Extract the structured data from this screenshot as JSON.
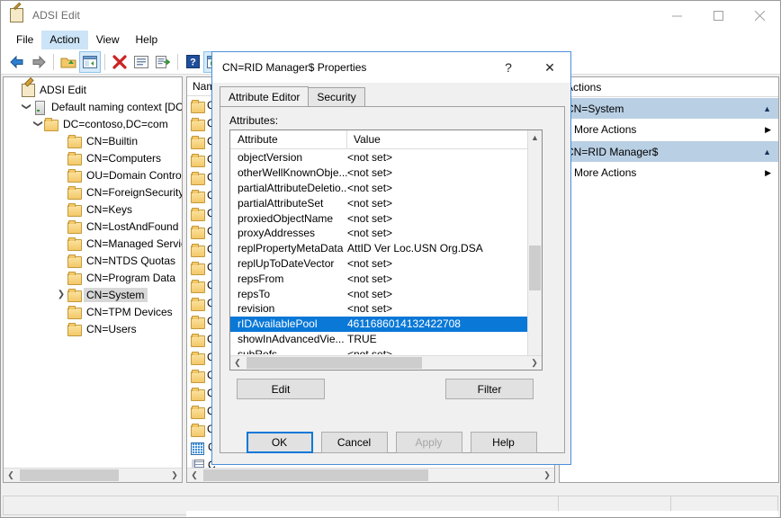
{
  "window": {
    "title": "ADSI Edit",
    "icon": "adsi-edit-icon",
    "minimize": "minimize-icon",
    "maximize": "maximize-icon",
    "close": "close-icon"
  },
  "menubar": {
    "items": [
      {
        "label": "File",
        "active": false
      },
      {
        "label": "Action",
        "active": true
      },
      {
        "label": "View",
        "active": false
      },
      {
        "label": "Help",
        "active": false
      }
    ]
  },
  "toolbar": {
    "buttons": [
      {
        "name": "back-icon",
        "selected": false
      },
      {
        "name": "forward-icon",
        "selected": false
      },
      {
        "name": "up-one-level-icon",
        "selected": false
      },
      {
        "name": "show-hide-console-tree-icon",
        "selected": true
      },
      {
        "name": "delete-icon",
        "selected": false
      },
      {
        "name": "properties-icon",
        "selected": false
      },
      {
        "name": "export-list-icon",
        "selected": false
      },
      {
        "name": "help-icon",
        "selected": false
      },
      {
        "name": "show-hide-action-pane-icon",
        "selected": true
      }
    ]
  },
  "tree": {
    "nodes": [
      {
        "label": "ADSI Edit",
        "indent": 0,
        "icon": "app-icon",
        "chevron": "",
        "selected": false
      },
      {
        "label": "Default naming context [DC",
        "indent": 1,
        "icon": "server-icon",
        "chevron": "expanded",
        "selected": false
      },
      {
        "label": "DC=contoso,DC=com",
        "indent": 2,
        "icon": "folder-icon",
        "chevron": "expanded",
        "selected": false
      },
      {
        "label": "CN=Builtin",
        "indent": 4,
        "icon": "folder-icon",
        "chevron": "",
        "selected": false
      },
      {
        "label": "CN=Computers",
        "indent": 4,
        "icon": "folder-icon",
        "chevron": "",
        "selected": false
      },
      {
        "label": "OU=Domain Control",
        "indent": 4,
        "icon": "folder-icon",
        "chevron": "",
        "selected": false
      },
      {
        "label": "CN=ForeignSecurityP",
        "indent": 4,
        "icon": "folder-icon",
        "chevron": "",
        "selected": false
      },
      {
        "label": "CN=Keys",
        "indent": 4,
        "icon": "folder-icon",
        "chevron": "",
        "selected": false
      },
      {
        "label": "CN=LostAndFound",
        "indent": 4,
        "icon": "folder-icon",
        "chevron": "",
        "selected": false
      },
      {
        "label": "CN=Managed Service",
        "indent": 4,
        "icon": "folder-icon",
        "chevron": "",
        "selected": false
      },
      {
        "label": "CN=NTDS Quotas",
        "indent": 4,
        "icon": "folder-icon",
        "chevron": "",
        "selected": false
      },
      {
        "label": "CN=Program Data",
        "indent": 4,
        "icon": "folder-icon",
        "chevron": "",
        "selected": false
      },
      {
        "label": "CN=System",
        "indent": 4,
        "icon": "folder-icon",
        "chevron": "collapsed",
        "selected": true
      },
      {
        "label": "CN=TPM Devices",
        "indent": 4,
        "icon": "folder-icon",
        "chevron": "",
        "selected": false
      },
      {
        "label": "CN=Users",
        "indent": 4,
        "icon": "folder-icon",
        "chevron": "",
        "selected": false
      }
    ]
  },
  "listpane": {
    "column_header": "Name",
    "rows": [
      {
        "icon": "folder-icon",
        "label": "C"
      },
      {
        "icon": "folder-icon",
        "label": "C"
      },
      {
        "icon": "folder-icon",
        "label": "C"
      },
      {
        "icon": "folder-icon",
        "label": "C"
      },
      {
        "icon": "folder-icon",
        "label": "C"
      },
      {
        "icon": "folder-icon",
        "label": "C"
      },
      {
        "icon": "folder-icon",
        "label": "C"
      },
      {
        "icon": "folder-icon",
        "label": "C"
      },
      {
        "icon": "folder-icon",
        "label": "C"
      },
      {
        "icon": "folder-icon",
        "label": "C"
      },
      {
        "icon": "folder-icon",
        "label": "C"
      },
      {
        "icon": "folder-icon",
        "label": "C"
      },
      {
        "icon": "folder-icon",
        "label": "C"
      },
      {
        "icon": "folder-icon",
        "label": "C"
      },
      {
        "icon": "folder-icon",
        "label": "C"
      },
      {
        "icon": "folder-icon",
        "label": "C"
      },
      {
        "icon": "folder-icon",
        "label": "C"
      },
      {
        "icon": "folder-icon",
        "label": "C"
      },
      {
        "icon": "folder-icon",
        "label": "C"
      },
      {
        "icon": "grid-icon",
        "label": "C"
      },
      {
        "icon": "document-icon",
        "label": "C"
      }
    ]
  },
  "actions": {
    "header": "Actions",
    "groups": [
      {
        "title": "CN=System",
        "caret": "collapse-caret-icon",
        "items": [
          {
            "label": "More Actions",
            "arrow": "submenu-arrow-icon"
          }
        ]
      },
      {
        "title": "CN=RID Manager$",
        "caret": "collapse-caret-icon",
        "items": [
          {
            "label": "More Actions",
            "arrow": "submenu-arrow-icon"
          }
        ]
      }
    ]
  },
  "dialog": {
    "title": "CN=RID Manager$ Properties",
    "help_button": "?",
    "close_button": "✕",
    "tabs": [
      {
        "label": "Attribute Editor",
        "active": true
      },
      {
        "label": "Security",
        "active": false
      }
    ],
    "attributes_label": "Attributes:",
    "columns": {
      "attribute": "Attribute",
      "value": "Value"
    },
    "rows": [
      {
        "attribute": "objectVersion",
        "value": "<not set>",
        "selected": false
      },
      {
        "attribute": "otherWellKnownObje...",
        "value": "<not set>",
        "selected": false
      },
      {
        "attribute": "partialAttributeDeletio...",
        "value": "<not set>",
        "selected": false
      },
      {
        "attribute": "partialAttributeSet",
        "value": "<not set>",
        "selected": false
      },
      {
        "attribute": "proxiedObjectName",
        "value": "<not set>",
        "selected": false
      },
      {
        "attribute": "proxyAddresses",
        "value": "<not set>",
        "selected": false
      },
      {
        "attribute": "replPropertyMetaData",
        "value": "AttID  Ver    Loc.USN                Org.DSA",
        "selected": false
      },
      {
        "attribute": "replUpToDateVector",
        "value": "<not set>",
        "selected": false
      },
      {
        "attribute": "repsFrom",
        "value": "<not set>",
        "selected": false
      },
      {
        "attribute": "repsTo",
        "value": "<not set>",
        "selected": false
      },
      {
        "attribute": "revision",
        "value": "<not set>",
        "selected": false
      },
      {
        "attribute": "rIDAvailablePool",
        "value": "4611686014132422708",
        "selected": true
      },
      {
        "attribute": "showInAdvancedVie...",
        "value": "TRUE",
        "selected": false
      },
      {
        "attribute": "subRefs",
        "value": "<not set>",
        "selected": false
      }
    ],
    "edit_button": "Edit",
    "filter_button": "Filter",
    "ok_button": "OK",
    "cancel_button": "Cancel",
    "apply_button": "Apply",
    "help_text_button": "Help"
  },
  "colors": {
    "selection_blue": "#0a78d7",
    "group_header_blue": "#b9cfe4",
    "tree_selection_gray": "#d8d8d8",
    "dialog_border": "#4a90d9"
  }
}
